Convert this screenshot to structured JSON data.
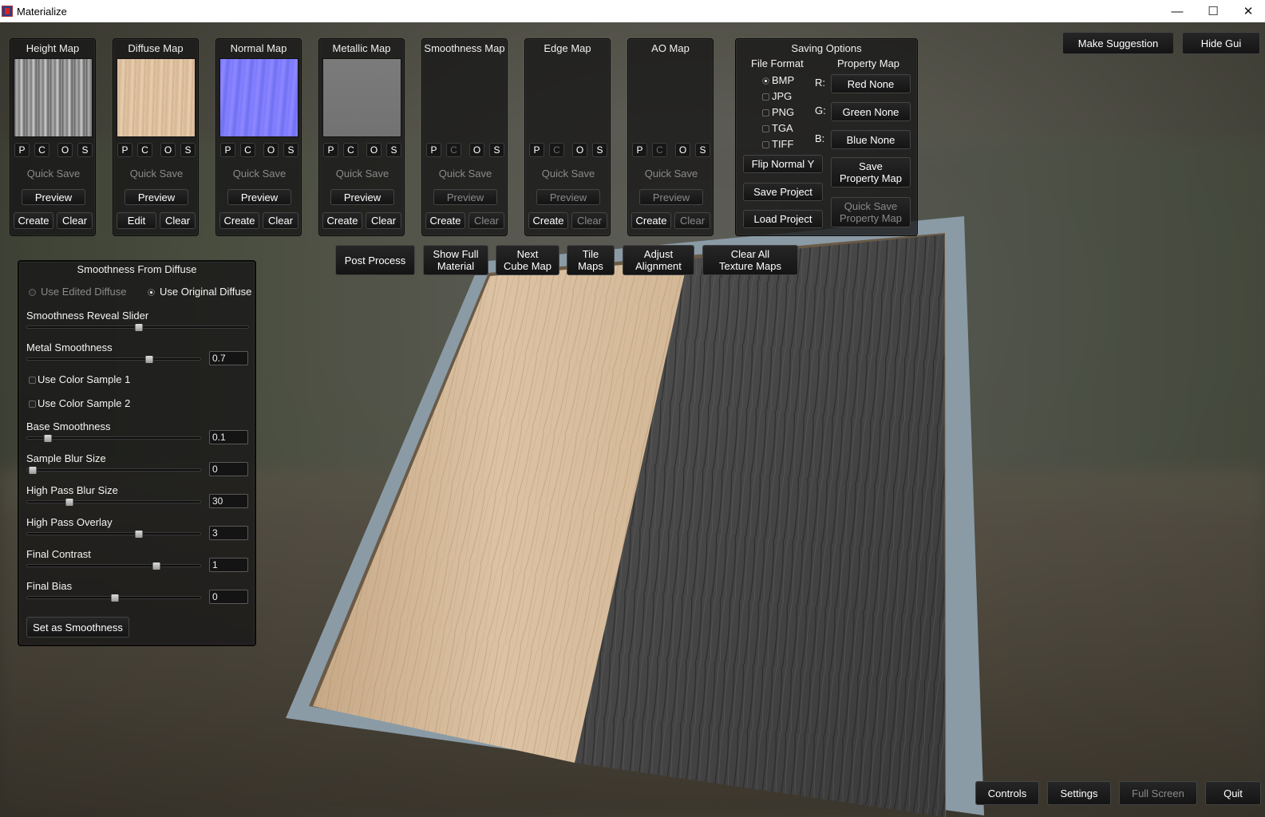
{
  "window": {
    "title": "Materialize"
  },
  "maps": [
    {
      "title": "Height Map",
      "pcos": [
        "P",
        "C",
        "O",
        "S"
      ],
      "c_enabled": true,
      "quick_save": "Quick Save",
      "preview": "Preview",
      "preview_enabled": true,
      "left_action": "Create",
      "right_action": "Clear",
      "clear_enabled": true,
      "thumb": "height"
    },
    {
      "title": "Diffuse Map",
      "pcos": [
        "P",
        "C",
        "O",
        "S"
      ],
      "c_enabled": true,
      "quick_save": "Quick Save",
      "preview": "Preview",
      "preview_enabled": true,
      "left_action": "Edit",
      "right_action": "Clear",
      "clear_enabled": true,
      "thumb": "diffuse"
    },
    {
      "title": "Normal Map",
      "pcos": [
        "P",
        "C",
        "O",
        "S"
      ],
      "c_enabled": true,
      "quick_save": "Quick Save",
      "preview": "Preview",
      "preview_enabled": true,
      "left_action": "Create",
      "right_action": "Clear",
      "clear_enabled": true,
      "thumb": "normal"
    },
    {
      "title": "Metallic Map",
      "pcos": [
        "P",
        "C",
        "O",
        "S"
      ],
      "c_enabled": true,
      "quick_save": "Quick Save",
      "preview": "Preview",
      "preview_enabled": true,
      "left_action": "Create",
      "right_action": "Clear",
      "clear_enabled": true,
      "thumb": "metallic"
    },
    {
      "title": "Smoothness Map",
      "pcos": [
        "P",
        "C",
        "O",
        "S"
      ],
      "c_enabled": false,
      "quick_save": "Quick Save",
      "preview": "Preview",
      "preview_enabled": false,
      "left_action": "Create",
      "right_action": "Clear",
      "clear_enabled": false,
      "thumb": "empty"
    },
    {
      "title": "Edge Map",
      "pcos": [
        "P",
        "C",
        "O",
        "S"
      ],
      "c_enabled": false,
      "quick_save": "Quick Save",
      "preview": "Preview",
      "preview_enabled": false,
      "left_action": "Create",
      "right_action": "Clear",
      "clear_enabled": false,
      "thumb": "empty"
    },
    {
      "title": "AO Map",
      "pcos": [
        "P",
        "C",
        "O",
        "S"
      ],
      "c_enabled": false,
      "quick_save": "Quick Save",
      "preview": "Preview",
      "preview_enabled": false,
      "left_action": "Create",
      "right_action": "Clear",
      "clear_enabled": false,
      "thumb": "empty"
    }
  ],
  "saving": {
    "title": "Saving Options",
    "file_format_label": "File Format",
    "property_map_label": "Property Map",
    "formats": [
      "BMP",
      "JPG",
      "PNG",
      "TGA",
      "TIFF"
    ],
    "selected_format": "BMP",
    "channels": [
      {
        "label": "R:",
        "value": "Red None"
      },
      {
        "label": "G:",
        "value": "Green None"
      },
      {
        "label": "B:",
        "value": "Blue None"
      }
    ],
    "flip_normal": "Flip Normal Y",
    "save_project": "Save Project",
    "load_project": "Load Project",
    "save_property_map": "Save\nProperty Map",
    "quick_save_property_map": "Quick Save\nProperty Map"
  },
  "toolbar": {
    "post_process": "Post Process",
    "show_full_material": "Show Full\nMaterial",
    "next_cube_map": "Next\nCube Map",
    "tile_maps": "Tile\nMaps",
    "adjust_alignment": "Adjust\nAlignment",
    "clear_all": "Clear All\nTexture Maps"
  },
  "top_right": {
    "make_suggestion": "Make Suggestion",
    "hide_gui": "Hide Gui"
  },
  "smoothness_panel": {
    "title": "Smoothness From Diffuse",
    "use_edited": "Use Edited Diffuse",
    "use_original": "Use Original Diffuse",
    "reveal_label": "Smoothness Reveal Slider",
    "reveal_value": 0.5,
    "metal_smoothness": {
      "label": "Metal Smoothness",
      "value": "0.7",
      "fraction": 0.7
    },
    "color_sample_1": "Use Color Sample 1",
    "color_sample_2": "Use Color Sample 2",
    "sliders": [
      {
        "label": "Base Smoothness",
        "value": "0.1",
        "fraction": 0.12
      },
      {
        "label": "Sample Blur Size",
        "value": "0",
        "fraction": 0.03
      },
      {
        "label": "High Pass Blur Size",
        "value": "30",
        "fraction": 0.24
      },
      {
        "label": "High Pass Overlay",
        "value": "3",
        "fraction": 0.64
      },
      {
        "label": "Final Contrast",
        "value": "1",
        "fraction": 0.74
      },
      {
        "label": "Final Bias",
        "value": "0",
        "fraction": 0.5
      }
    ],
    "set_button": "Set as Smoothness"
  },
  "bottom": {
    "controls": "Controls",
    "settings": "Settings",
    "full_screen": "Full Screen",
    "quit": "Quit"
  }
}
